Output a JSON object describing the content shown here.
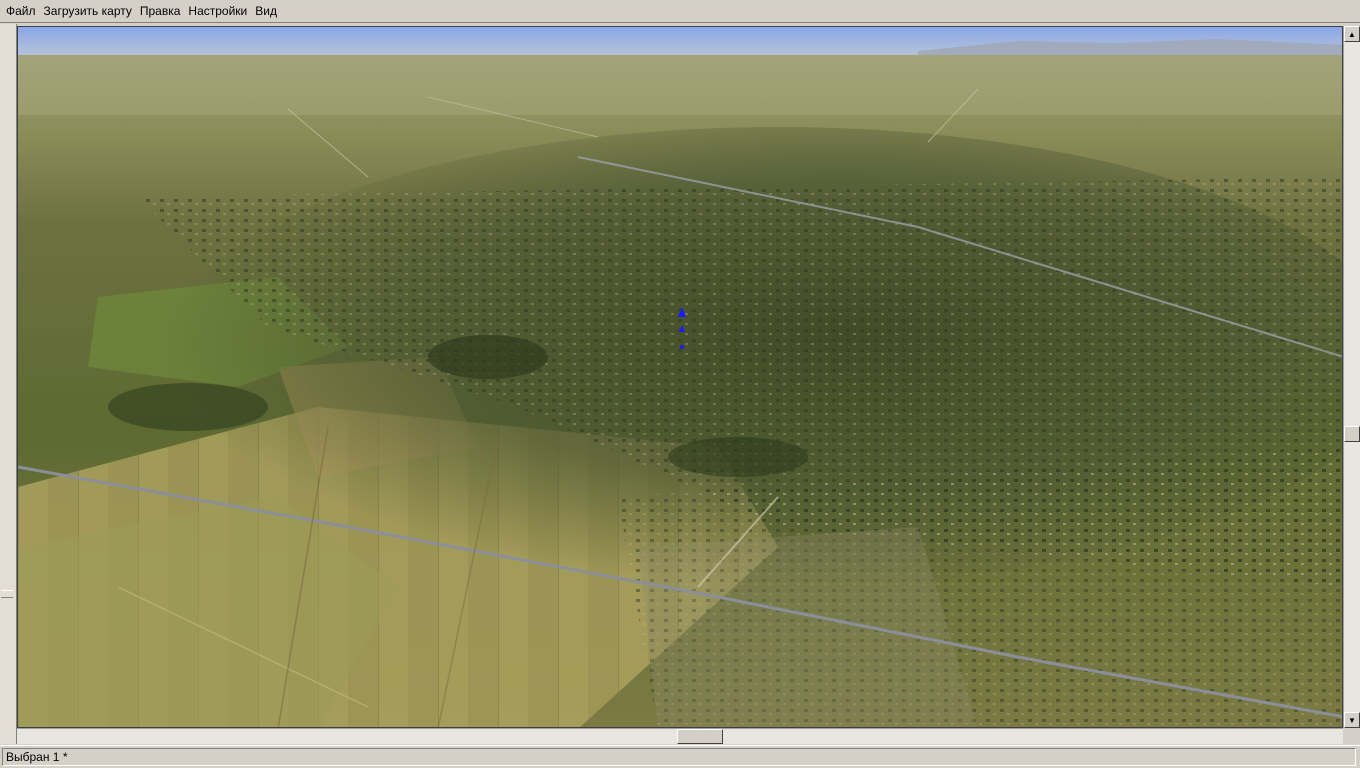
{
  "menu": {
    "items": [
      {
        "label": "Файл"
      },
      {
        "label": "Загрузить карту"
      },
      {
        "label": "Правка"
      },
      {
        "label": "Настройки"
      },
      {
        "label": "Вид"
      }
    ]
  },
  "status": {
    "text": "Выбран 1 *"
  },
  "scene": {
    "description_icon": "aerial-terrain-view",
    "marker_color": "#1a1aff"
  }
}
